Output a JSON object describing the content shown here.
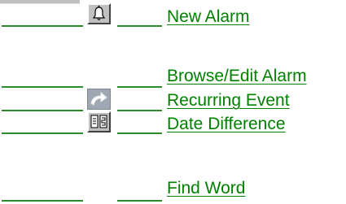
{
  "links": [
    {
      "label": "New Alarm",
      "icon": "bell-icon"
    },
    {
      "label": "Browse/Edit Alarm",
      "icon": null
    },
    {
      "label": "Recurring Event",
      "icon": "recurring-arrow-icon"
    },
    {
      "label": "Date Difference",
      "icon": "calendar-diff-icon"
    },
    {
      "label": "Find Word",
      "icon": null
    }
  ],
  "colors": {
    "link": "#008000",
    "underline": "#2e8b2e",
    "button_face": "#c0c0c0"
  }
}
